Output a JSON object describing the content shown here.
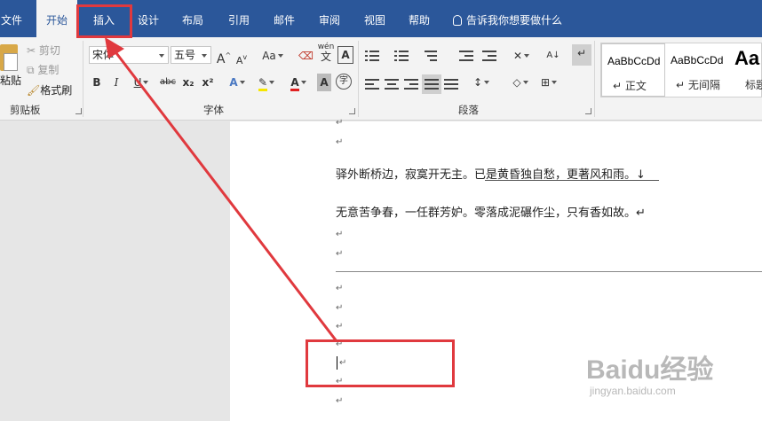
{
  "tabs": [
    {
      "label": "文件"
    },
    {
      "label": "开始",
      "active": true
    },
    {
      "label": "插入"
    },
    {
      "label": "设计"
    },
    {
      "label": "布局"
    },
    {
      "label": "引用"
    },
    {
      "label": "邮件"
    },
    {
      "label": "审阅"
    },
    {
      "label": "视图"
    },
    {
      "label": "帮助"
    }
  ],
  "tell_me": "告诉我你想要做什么",
  "clipboard": {
    "paste": "粘贴",
    "cut": "剪切",
    "copy": "复制",
    "format_painter": "格式刷",
    "group_label": "剪贴板"
  },
  "font": {
    "font_name": "宋体",
    "font_size": "五号",
    "case_label": "Aa",
    "wen_label": "wén",
    "wen_char": "文",
    "bold": "B",
    "italic": "I",
    "underline": "U",
    "strike": "abc",
    "subscript": "x₂",
    "superscript": "x²",
    "grow": "A",
    "shrink": "A",
    "group_label": "字体"
  },
  "paragraph": {
    "group_label": "段落"
  },
  "styles": [
    {
      "sample": "AaBbCcDd",
      "name": "↵ 正文"
    },
    {
      "sample": "AaBbCcDd",
      "name": "↵ 无间隔"
    },
    {
      "sample": "Aa",
      "name": "标题"
    }
  ],
  "document": {
    "line1": "驿外断桥边，寂寞开无主。已是黄昏独自愁，更著风和雨。↓",
    "line2": "无意苦争春，一任群芳妒。零落成泥碾作尘，只有香如故。↵",
    "para_mark": "↵"
  },
  "watermark": {
    "logo": "Baidu经验",
    "url": "jingyan.baidu.com"
  },
  "colors": {
    "accent": "#2b579a",
    "highlight": "#e0393e"
  }
}
